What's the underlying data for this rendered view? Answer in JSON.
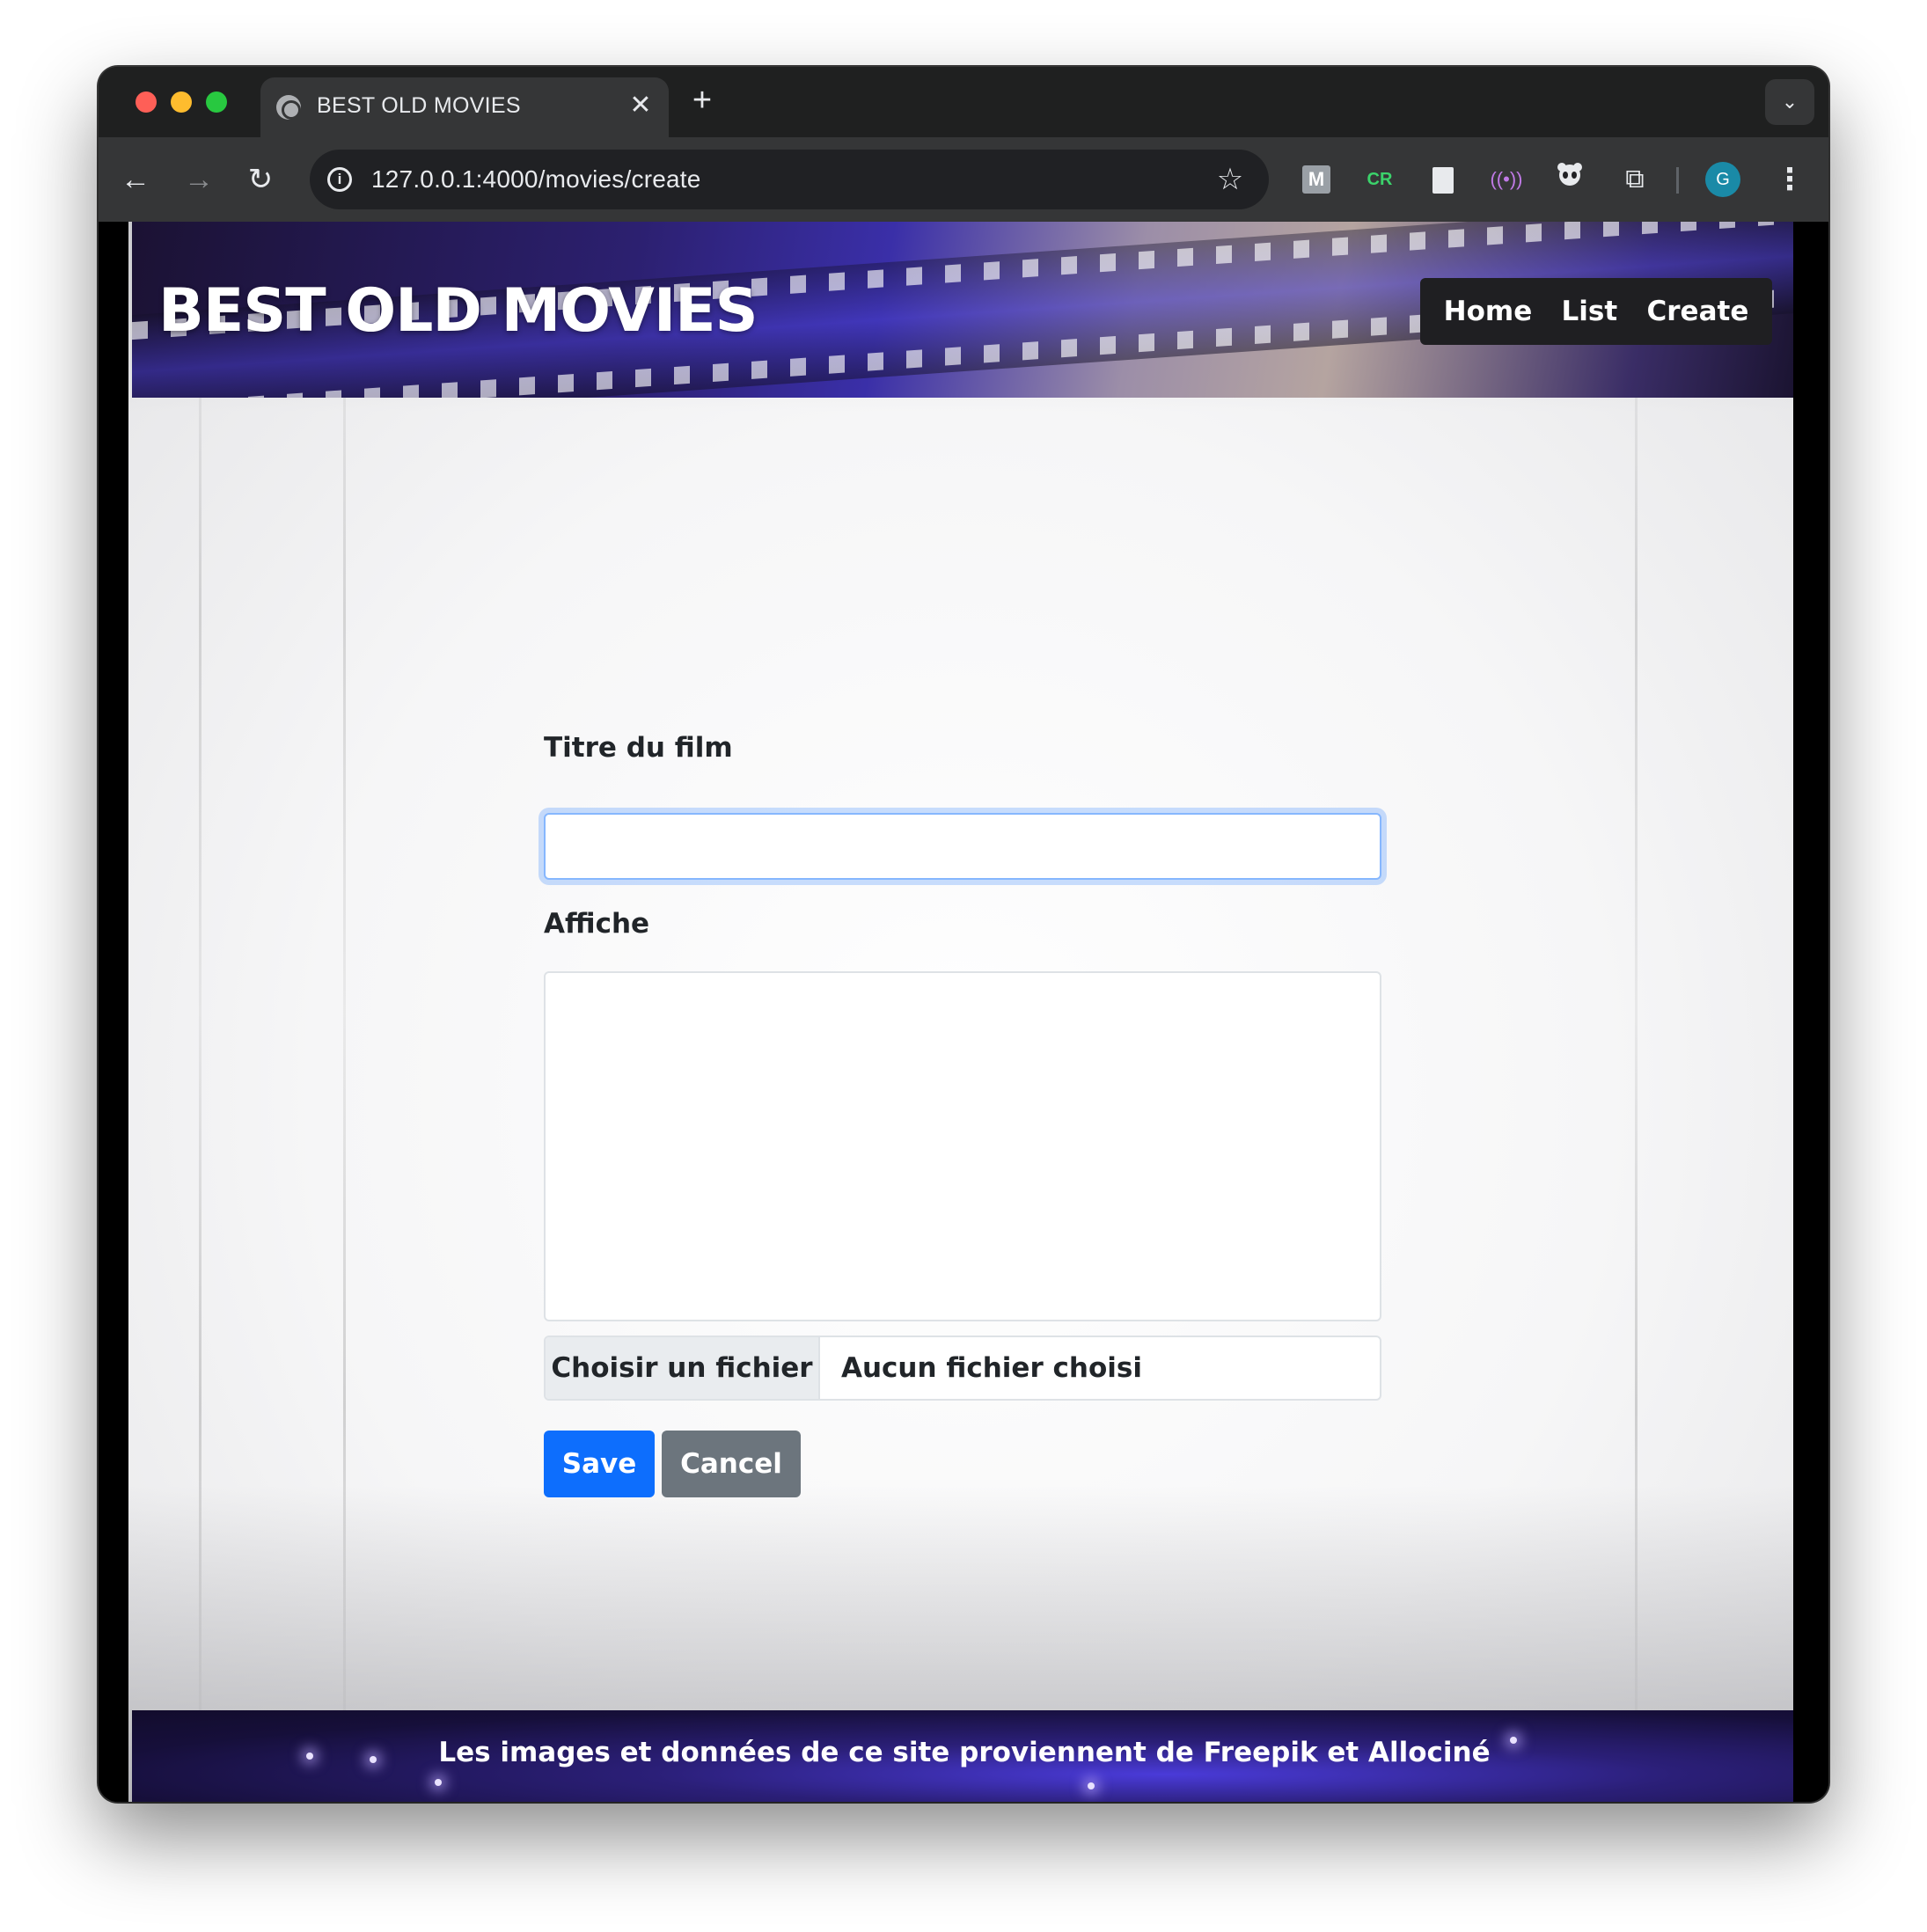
{
  "browser": {
    "tab_title": "BEST OLD MOVIES",
    "tab_close": "✕",
    "new_tab": "+",
    "url": "127.0.0.1:4000/movies/create",
    "avatar_letter": "G",
    "extensions": [
      "M",
      "CR",
      "doc-icon",
      "radio-icon",
      "panda-icon",
      "puzzle-icon"
    ]
  },
  "header": {
    "brand": "BEST OLD MOVIES",
    "nav": [
      "Home",
      "List",
      "Create"
    ]
  },
  "form": {
    "title_label": "Titre du film",
    "title_value": "",
    "poster_label": "Affiche",
    "poster_value": "",
    "file_button": "Choisir un fichier",
    "file_status": "Aucun fichier choisi",
    "save_label": "Save",
    "cancel_label": "Cancel"
  },
  "footer": {
    "text": "Les images et données de ce site proviennent de Freepik et Allociné"
  },
  "colors": {
    "primary": "#0d6efd",
    "secondary": "#6c757d",
    "focus_ring": "#86b7fe"
  }
}
